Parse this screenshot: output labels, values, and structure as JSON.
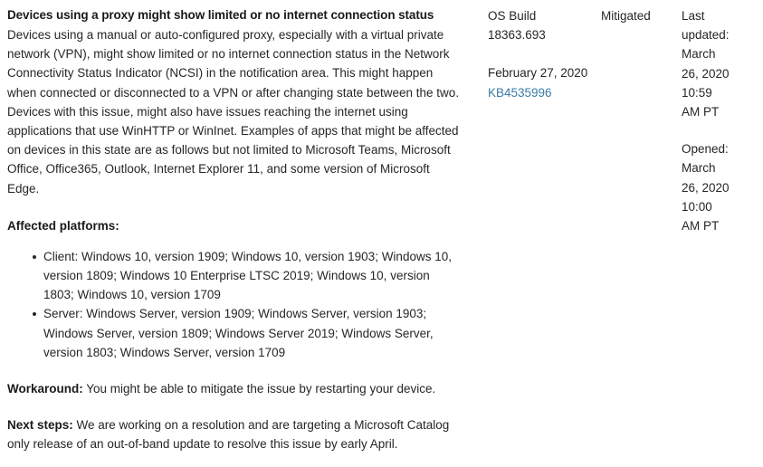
{
  "issue": {
    "title": "Devices using a proxy might show limited or no internet connection status",
    "description": "Devices using a manual or auto-configured proxy, especially with a virtual private network (VPN), might show limited or no internet connection status in the Network Connectivity Status Indicator (NCSI) in the notification area.  This might happen when connected or disconnected to a VPN or after changing state between the two. Devices with this issue, might also have issues reaching the internet using applications that use WinHTTP or WinInet. Examples of apps that might be affected on devices in this state are as follows but not limited to Microsoft Teams, Microsoft Office, Office365, Outlook, Internet Explorer 11, and some version of Microsoft Edge.",
    "affected_platforms_heading": "Affected platforms:",
    "platforms": [
      "Client: Windows 10, version 1909; Windows 10, version 1903; Windows 10, version 1809; Windows 10 Enterprise LTSC 2019; Windows 10, version 1803; Windows 10, version 1709",
      "Server: Windows Server, version 1909; Windows Server, version 1903; Windows Server, version 1809; Windows Server 2019; Windows Server, version 1803; Windows Server, version 1709"
    ],
    "workaround_label": "Workaround:",
    "workaround_text": " You might be able to mitigate the issue by restarting your device.",
    "next_steps_label": "Next steps:",
    "next_steps_text": " We are working on a resolution and are targeting a Microsoft Catalog only release of an out-of-band update to resolve this issue by early April."
  },
  "os_build": {
    "label": "OS Build",
    "number": "18363.693",
    "release_date": "February 27, 2020",
    "kb_article": "KB4535996"
  },
  "status": {
    "value": "Mitigated"
  },
  "dates": {
    "last_updated_label": "Last updated:",
    "last_updated_value": "March 26, 2020 10:59 AM PT",
    "opened_label": "Opened:",
    "opened_value": "March 26, 2020 10:00 AM PT"
  },
  "colors": {
    "link": "#3b7ca8",
    "text": "#262626",
    "heading": "#1a1a1a",
    "background": "#ffffff"
  }
}
